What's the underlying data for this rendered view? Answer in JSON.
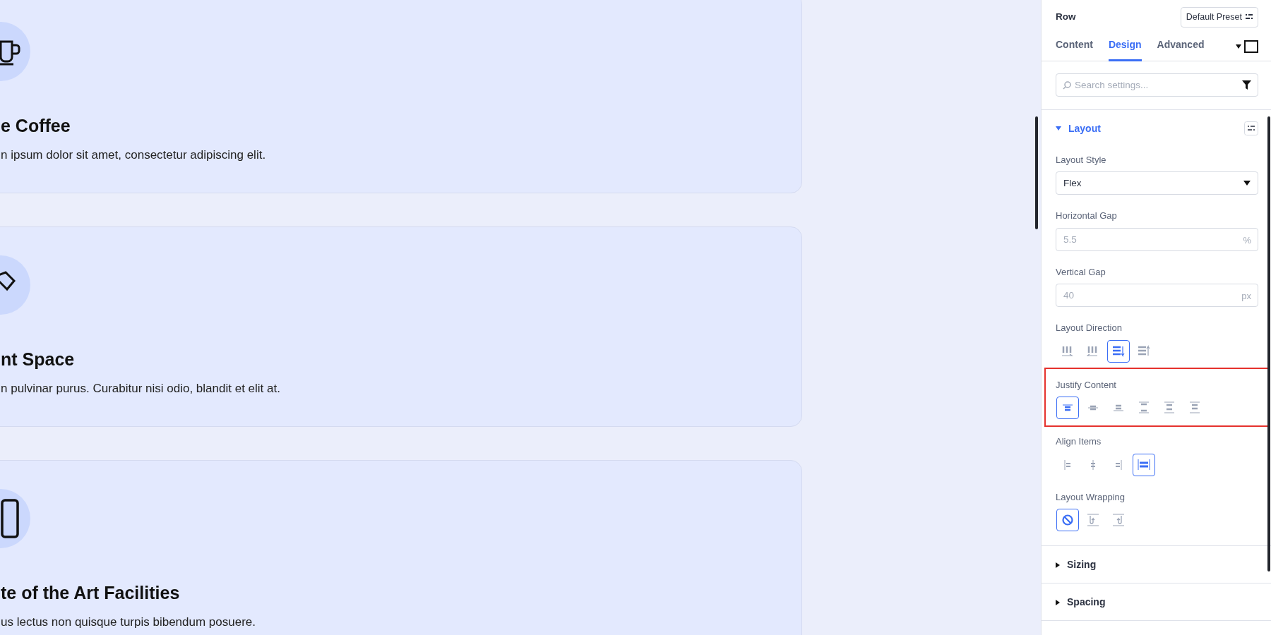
{
  "cards": [
    {
      "title": "e Coffee",
      "text": "n ipsum dolor sit amet, consectetur adipiscing elit."
    },
    {
      "title": "nt Space",
      "text": "n pulvinar purus. Curabitur nisi odio, blandit et elit at."
    },
    {
      "title": "te of the Art Facilities",
      "text": "us lectus non quisque turpis bibendum posuere."
    }
  ],
  "panel": {
    "title": "Row",
    "preset_button": "Default Preset",
    "tabs": [
      {
        "label": "Content",
        "selected": false
      },
      {
        "label": "Design",
        "selected": true
      },
      {
        "label": "Advanced",
        "selected": false
      }
    ],
    "search": {
      "placeholder": "Search settings..."
    },
    "sections": [
      {
        "title": "Layout",
        "expanded": true,
        "fields": [
          {
            "kind": "select",
            "label": "Layout Style",
            "value": "Flex"
          },
          {
            "kind": "unit",
            "label": "Horizontal Gap",
            "placeholder": "5.5",
            "unit": "%"
          },
          {
            "kind": "unit",
            "label": "Vertical Gap",
            "placeholder": "40",
            "unit": "px"
          },
          {
            "kind": "direction",
            "label": "Layout Direction",
            "highlighted": false,
            "options": [
              {
                "selected": false
              },
              {
                "selected": false
              },
              {
                "selected": true
              },
              {
                "selected": false
              }
            ]
          },
          {
            "kind": "justify",
            "label": "Justify Content",
            "highlighted": true,
            "options": [
              {
                "selected": true
              },
              {
                "selected": false
              },
              {
                "selected": false
              },
              {
                "selected": false
              },
              {
                "selected": false
              },
              {
                "selected": false
              }
            ]
          },
          {
            "kind": "align",
            "label": "Align Items",
            "highlighted": false,
            "options": [
              {
                "selected": false
              },
              {
                "selected": false
              },
              {
                "selected": false
              },
              {
                "selected": true
              }
            ]
          },
          {
            "kind": "wrap",
            "label": "Layout Wrapping",
            "highlighted": false,
            "options": [
              {
                "selected": true
              },
              {
                "selected": false
              },
              {
                "selected": false
              }
            ]
          }
        ]
      },
      {
        "title": "Sizing",
        "expanded": false
      },
      {
        "title": "Spacing",
        "expanded": false
      }
    ]
  }
}
